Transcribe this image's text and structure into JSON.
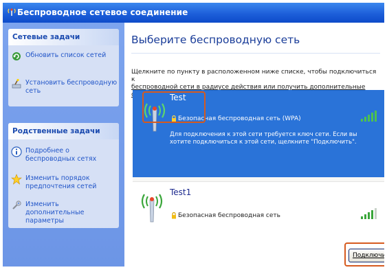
{
  "window": {
    "title": "Беспроводное сетевое соединение"
  },
  "sidebar": {
    "network_tasks": {
      "header": "Сетевые задачи",
      "items": [
        {
          "label": "Обновить список сетей",
          "icon": "refresh-icon"
        },
        {
          "label": "Установить беспроводную сеть",
          "icon": "wizard-icon"
        }
      ]
    },
    "related_tasks": {
      "header": "Родственные задачи",
      "items": [
        {
          "label": "Подробнее о беспроводных сетях",
          "icon": "info-icon"
        },
        {
          "label": "Изменить порядок предпочтения сетей",
          "icon": "star-icon"
        },
        {
          "label": "Изменить дополнительные параметры",
          "icon": "settings-icon"
        }
      ]
    }
  },
  "main": {
    "heading": "Выберите беспроводную сеть",
    "instruction_line1": "Щелкните по пункту в расположенном ниже списке, чтобы подключиться к",
    "instruction_line2": "беспроводной сети в радиусе действия или получить дополнительные сведения.",
    "networks": [
      {
        "ssid": "Test",
        "security": "Безопасная беспроводная сеть (WPA)",
        "description": "Для подключения к этой сети требуется ключ сети. Если вы хотите подключиться к этой сети, щелкните \"Подключить\".",
        "signal_bars": 5,
        "selected": true
      },
      {
        "ssid": "Test1",
        "security": "Безопасная беспроводная сеть",
        "signal_bars": 4,
        "selected": false
      }
    ],
    "connect_button": "Подключить"
  },
  "colors": {
    "title_bar": "#1d5fda",
    "sidebar": "#6c95e6",
    "selected_row": "#2a73d8",
    "highlight": "#d65a1e",
    "signal_green": "#3aa63a"
  }
}
